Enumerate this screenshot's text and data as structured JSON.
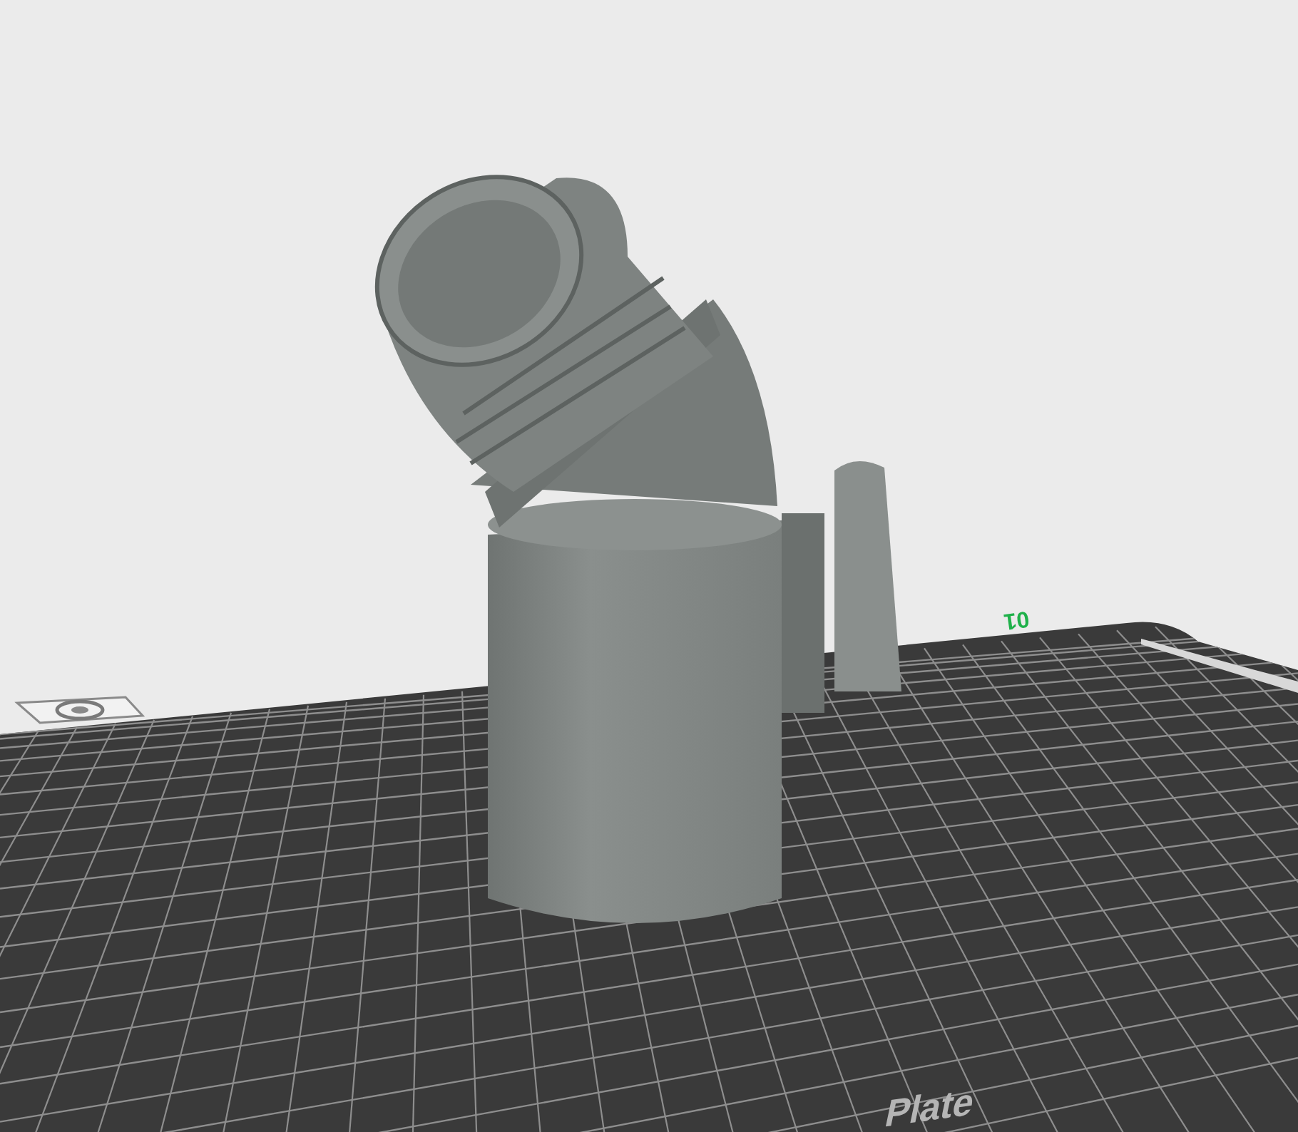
{
  "viewport": {
    "plate_number": "01",
    "plate_label": "Plate"
  }
}
